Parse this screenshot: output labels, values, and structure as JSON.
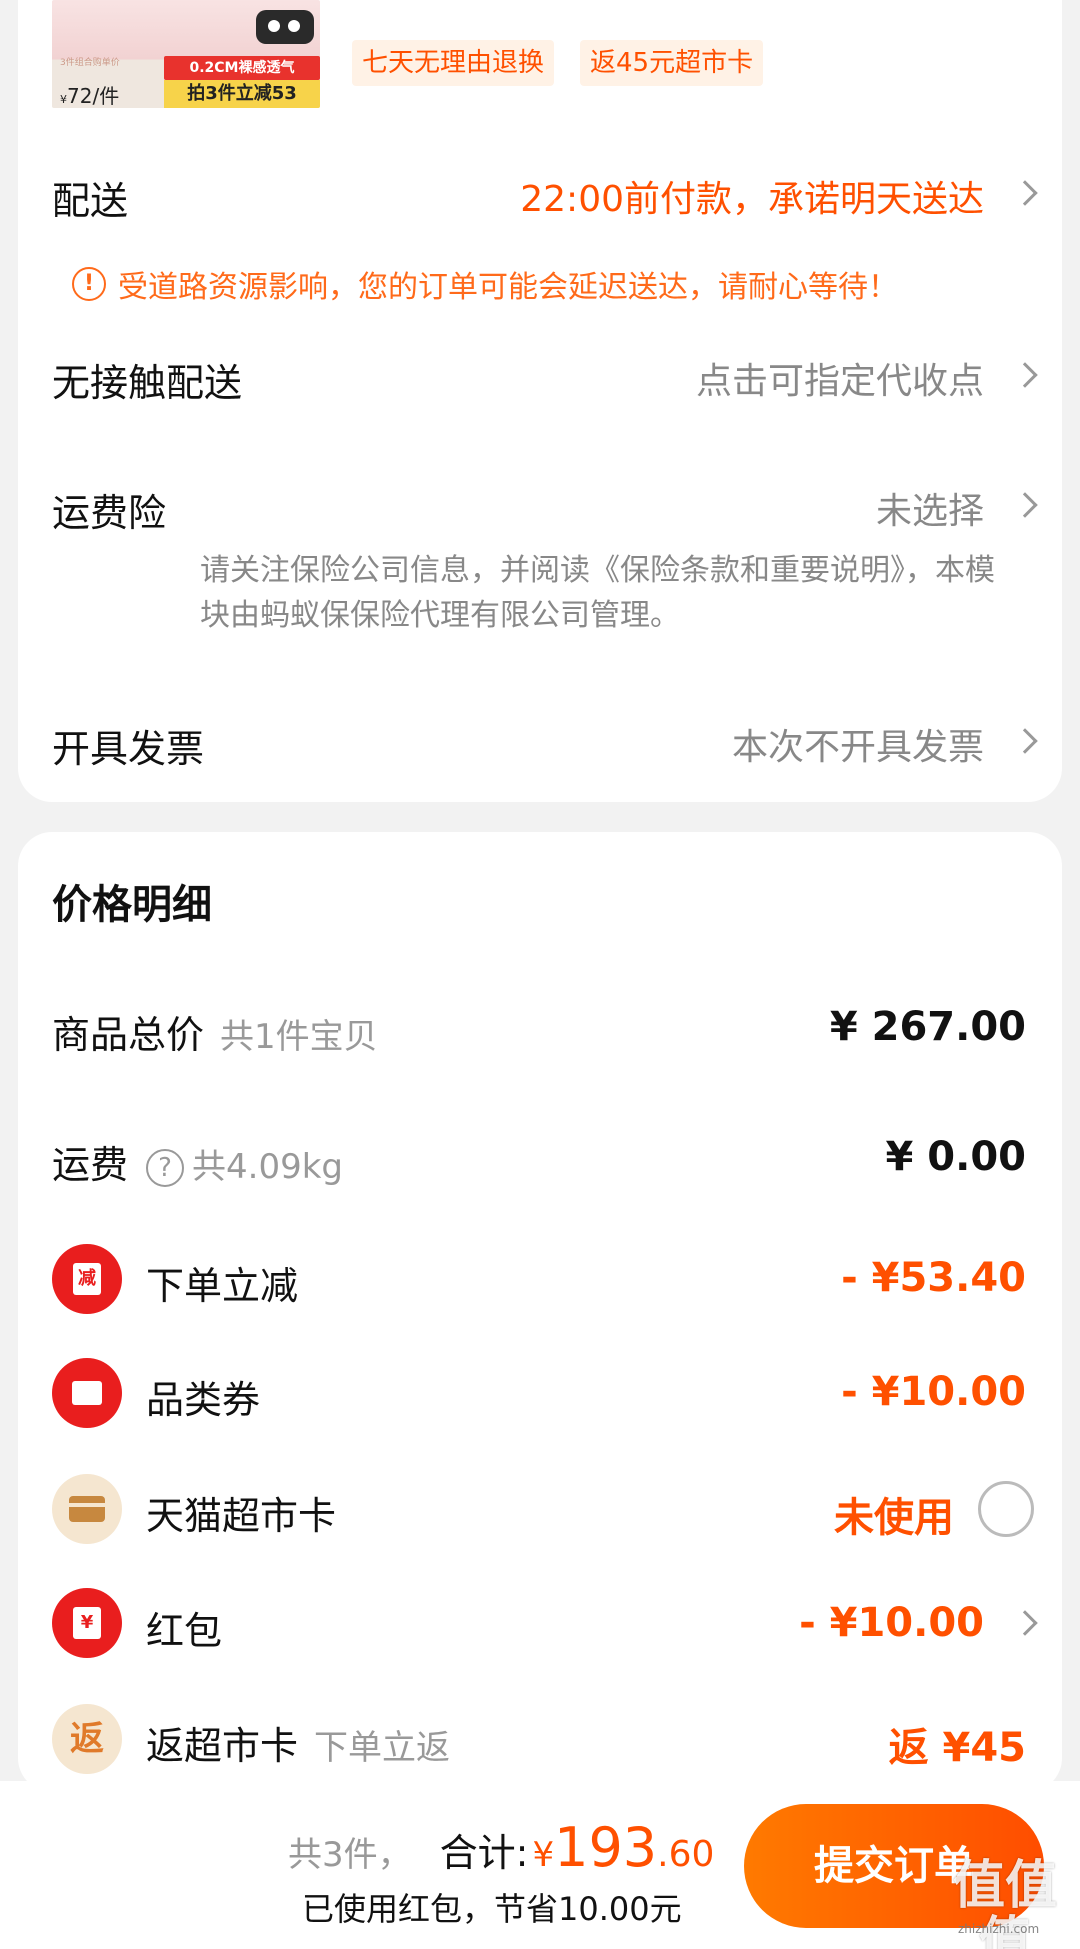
{
  "product": {
    "thumb_mini_text": "3件组合购单价",
    "thumb_price": "72/件",
    "thumb_price_symbol": "¥",
    "badge_red": "0.2CM裸感透气",
    "badge_yellow": "拍3件立减53"
  },
  "service_tags": [
    "七天无理由退换",
    "返45元超市卡"
  ],
  "delivery": {
    "label": "配送",
    "value": "22:00前付款，承诺明天送达",
    "notice": "受道路资源影响，您的订单可能会延迟送达，请耐心等待！",
    "notice_icon": "!"
  },
  "contactless": {
    "label": "无接触配送",
    "value": "点击可指定代收点"
  },
  "shipping_insurance": {
    "label": "运费险",
    "value": "未选择",
    "note": "请关注保险公司信息，并阅读《保险条款和重要说明》，本模块由蚂蚁保保险代理有限公司管理。"
  },
  "invoice": {
    "label": "开具发票",
    "value": "本次不开具发票"
  },
  "price_detail": {
    "title": "价格明细",
    "goods_total": {
      "label": "商品总价",
      "sub": "共1件宝贝",
      "amount": "¥ 267.00"
    },
    "shipping": {
      "label": "运费",
      "help_icon": "?",
      "sub": "共4.09kg",
      "amount": "¥ 0.00"
    },
    "discounts": [
      {
        "label": "下单立减",
        "amount": "- ¥53.40",
        "icon": "减"
      },
      {
        "label": "品类券",
        "amount": "- ¥10.00",
        "icon": "coupon-icon"
      },
      {
        "label": "天猫超市卡",
        "amount": "未使用",
        "icon": "card-icon"
      },
      {
        "label": "红包",
        "amount": "- ¥10.00",
        "icon": "¥"
      },
      {
        "label": "返超市卡",
        "sub": "下单立返",
        "amount": "返 ¥45",
        "icon": "返"
      }
    ]
  },
  "bottom": {
    "count": "共3件，",
    "total_label": "合计:",
    "total_symbol": "¥",
    "total_int": "193",
    "total_dec": ".60",
    "saving": "已使用红包，节省10.00元",
    "submit": "提交订单",
    "watermark": "值值值",
    "watermark_url": "zhizhizhi.com"
  },
  "colors": {
    "accent": "#ff5000",
    "discount_red": "#e91e1e",
    "gray_text": "#888888"
  }
}
